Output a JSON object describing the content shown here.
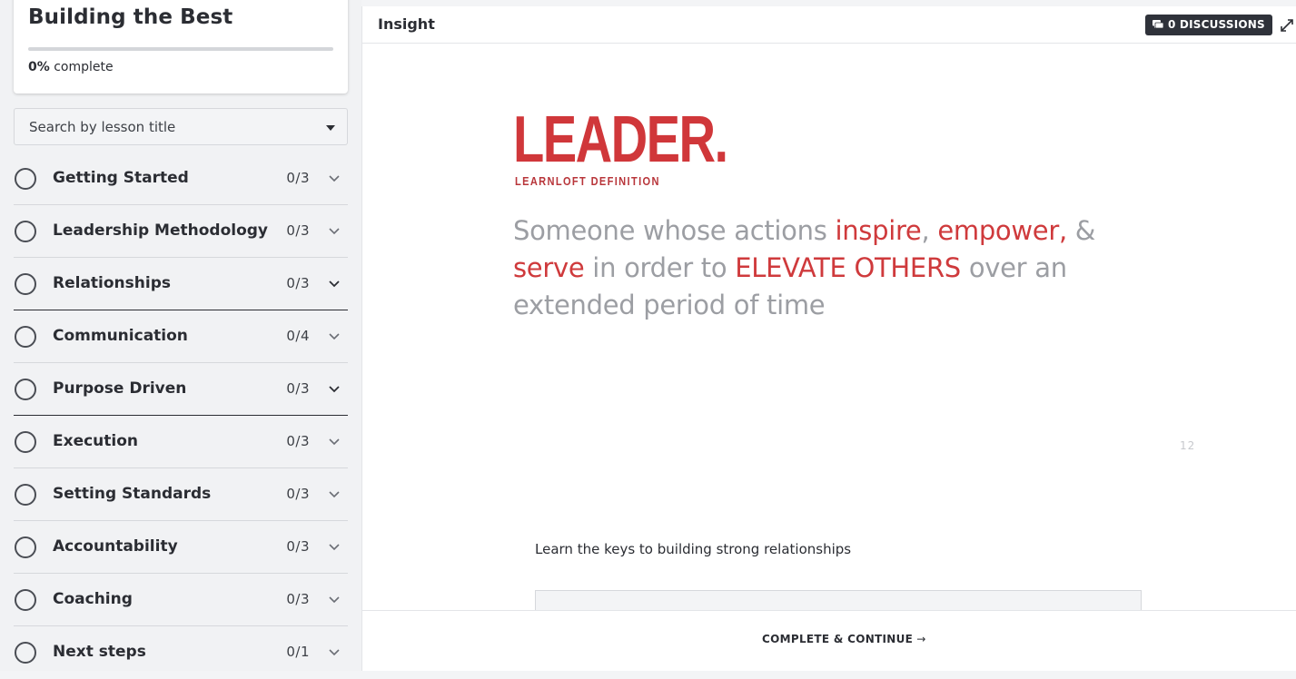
{
  "course": {
    "title": "Building the Best",
    "progress_percent": 0,
    "progress_value": "0%",
    "progress_suffix": " complete"
  },
  "search": {
    "placeholder": "Search by lesson title"
  },
  "chapters": [
    {
      "title": "Getting Started",
      "count": "0/3"
    },
    {
      "title": "Leadership Methodology",
      "count": "0/3"
    },
    {
      "title": "Relationships",
      "count": "0/3"
    },
    {
      "title": "Communication",
      "count": "0/4"
    },
    {
      "title": "Purpose Driven",
      "count": "0/3"
    },
    {
      "title": "Execution",
      "count": "0/3"
    },
    {
      "title": "Setting Standards",
      "count": "0/3"
    },
    {
      "title": "Accountability",
      "count": "0/3"
    },
    {
      "title": "Coaching",
      "count": "0/3"
    },
    {
      "title": "Next steps",
      "count": "0/1"
    }
  ],
  "topbar": {
    "lesson_type": "Insight",
    "discussions_label": "0 DISCUSSIONS"
  },
  "slide": {
    "heading": "LEADER.",
    "subheading": "LEARNLOFT DEFINITION",
    "def_1": "Someone whose actions ",
    "def_inspire": "inspire",
    "def_2": ", ",
    "def_empower": "empower,",
    "def_3": " & ",
    "def_serve": "serve",
    "def_4": " in order to ",
    "def_elevate": "ELEVATE OTHERS",
    "def_5": " over an extended period of time",
    "page_number": "12"
  },
  "lesson": {
    "description": "Learn the keys to building strong relationships"
  },
  "footer": {
    "complete_label": "COMPLETE & CONTINUE",
    "arrow": "→"
  },
  "colors": {
    "accent_red": "#d0373a",
    "dark": "#2b2d33",
    "discussion_bg": "#2f323a"
  }
}
